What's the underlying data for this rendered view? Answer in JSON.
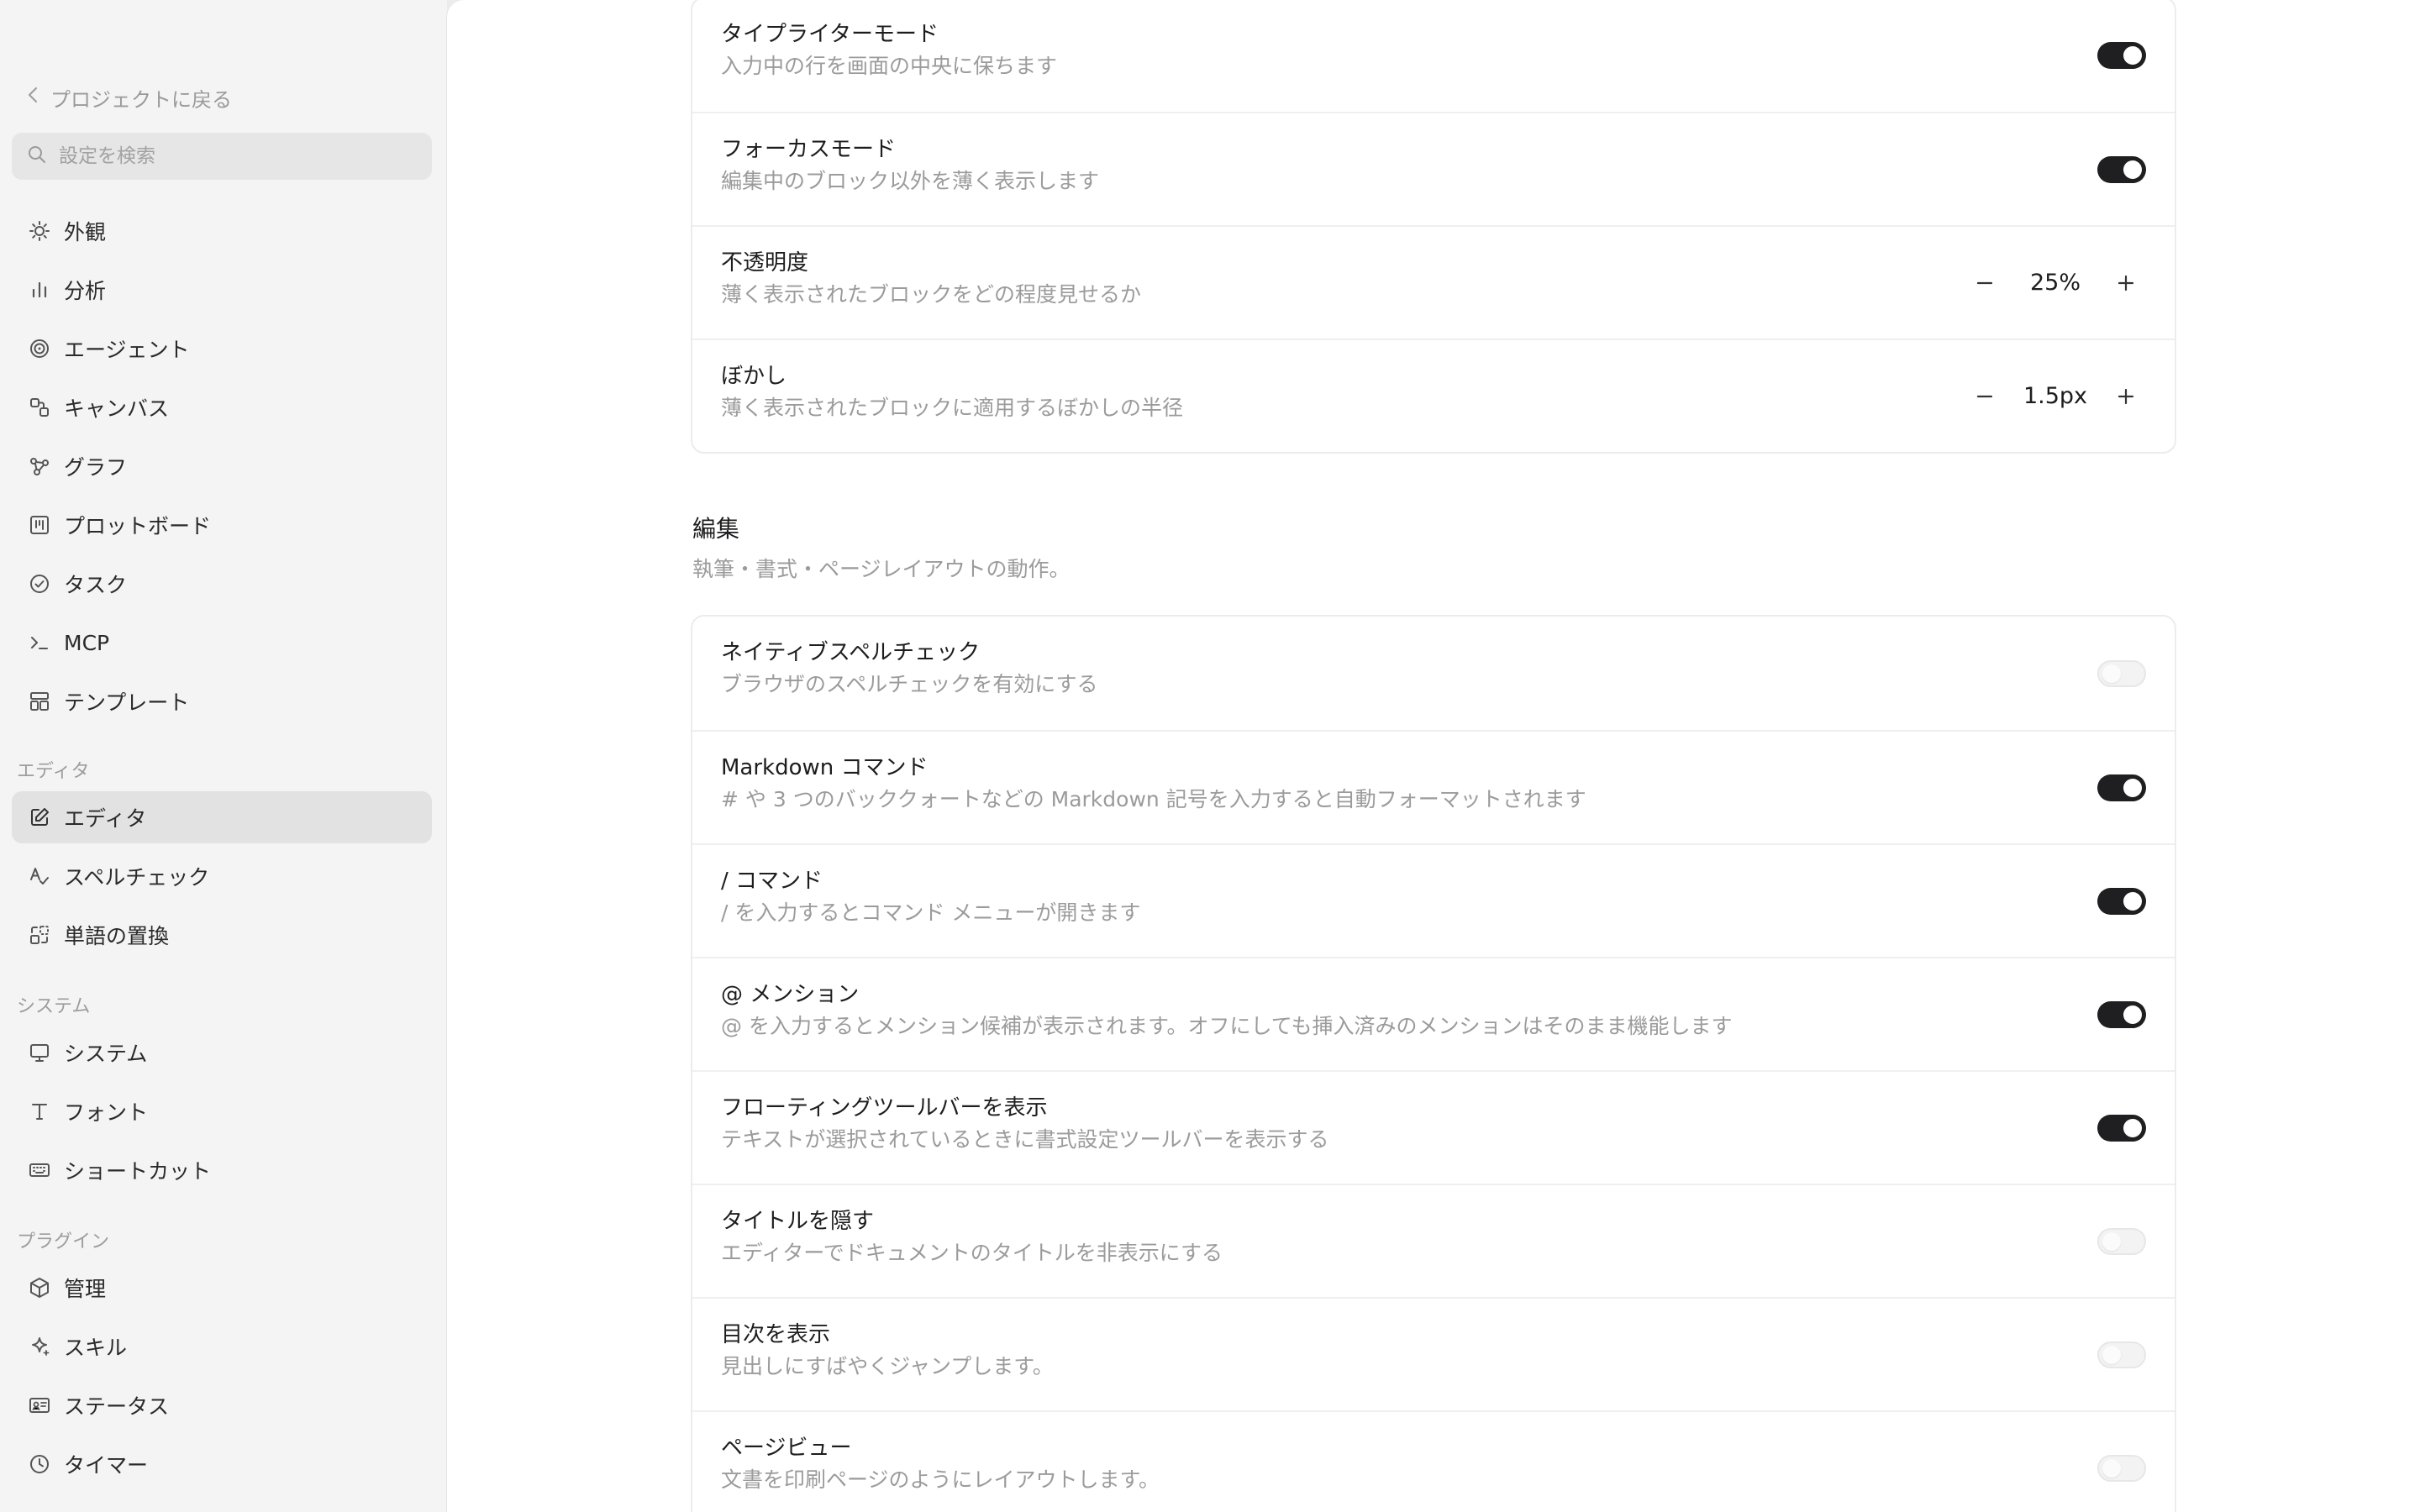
{
  "sidebar": {
    "back_label": "プロジェクトに戻る",
    "search_placeholder": "設定を検索",
    "items": [
      {
        "label": "外観",
        "icon": "sun-icon"
      },
      {
        "label": "分析",
        "icon": "bar-chart-icon"
      },
      {
        "label": "エージェント",
        "icon": "spiral-icon"
      },
      {
        "label": "キャンバス",
        "icon": "canvas-icon"
      },
      {
        "label": "グラフ",
        "icon": "graph-icon"
      },
      {
        "label": "プロットボード",
        "icon": "board-icon"
      },
      {
        "label": "タスク",
        "icon": "check-circle-icon"
      },
      {
        "label": "MCP",
        "icon": "terminal-icon"
      },
      {
        "label": "テンプレート",
        "icon": "template-icon"
      }
    ],
    "section_editor": "エディタ",
    "editor_items": [
      {
        "label": "エディタ",
        "icon": "edit-icon",
        "active": true
      },
      {
        "label": "スペルチェック",
        "icon": "spellcheck-icon"
      },
      {
        "label": "単語の置換",
        "icon": "replace-icon"
      }
    ],
    "section_system": "システム",
    "system_items": [
      {
        "label": "システム",
        "icon": "monitor-icon"
      },
      {
        "label": "フォント",
        "icon": "font-icon"
      },
      {
        "label": "ショートカット",
        "icon": "keyboard-icon"
      }
    ],
    "section_plugins": "プラグイン",
    "plugin_items": [
      {
        "label": "管理",
        "icon": "package-icon"
      },
      {
        "label": "スキル",
        "icon": "sparkle-icon"
      },
      {
        "label": "ステータス",
        "icon": "id-card-icon"
      },
      {
        "label": "タイマー",
        "icon": "clock-icon"
      }
    ]
  },
  "focus_card": {
    "rows": [
      {
        "title": "タイプライターモード",
        "desc": "入力中の行を画面の中央に保ちます",
        "toggle": true
      },
      {
        "title": "フォーカスモード",
        "desc": "編集中のブロック以外を薄く表示します",
        "toggle": true
      },
      {
        "title": "不透明度",
        "desc": "薄く表示されたブロックをどの程度見せるか",
        "value": "25%"
      },
      {
        "title": "ぼかし",
        "desc": "薄く表示されたブロックに適用するぼかしの半径",
        "value": "1.5px"
      }
    ]
  },
  "editing": {
    "title": "編集",
    "desc": "執筆・書式・ページレイアウトの動作。",
    "rows": [
      {
        "title": "ネイティブスペルチェック",
        "desc": "ブラウザのスペルチェックを有効にする",
        "toggle": false
      },
      {
        "title": "Markdown コマンド",
        "desc": "# や 3 つのバッククォートなどの Markdown 記号を入力すると自動フォーマットされます",
        "toggle": true
      },
      {
        "title": "/ コマンド",
        "desc": "/ を入力するとコマンド メニューが開きます",
        "toggle": true
      },
      {
        "title": "@ メンション",
        "desc": "@ を入力するとメンション候補が表示されます。オフにしても挿入済みのメンションはそのまま機能します",
        "toggle": true
      },
      {
        "title": "フローティングツールバーを表示",
        "desc": "テキストが選択されているときに書式設定ツールバーを表示する",
        "toggle": true
      },
      {
        "title": "タイトルを隠す",
        "desc": "エディターでドキュメントのタイトルを非表示にする",
        "toggle": false
      },
      {
        "title": "目次を表示",
        "desc": "見出しにすばやくジャンプします。",
        "toggle": false
      },
      {
        "title": "ページビュー",
        "desc": "文書を印刷ページのようにレイアウトします。",
        "toggle": false
      }
    ]
  }
}
